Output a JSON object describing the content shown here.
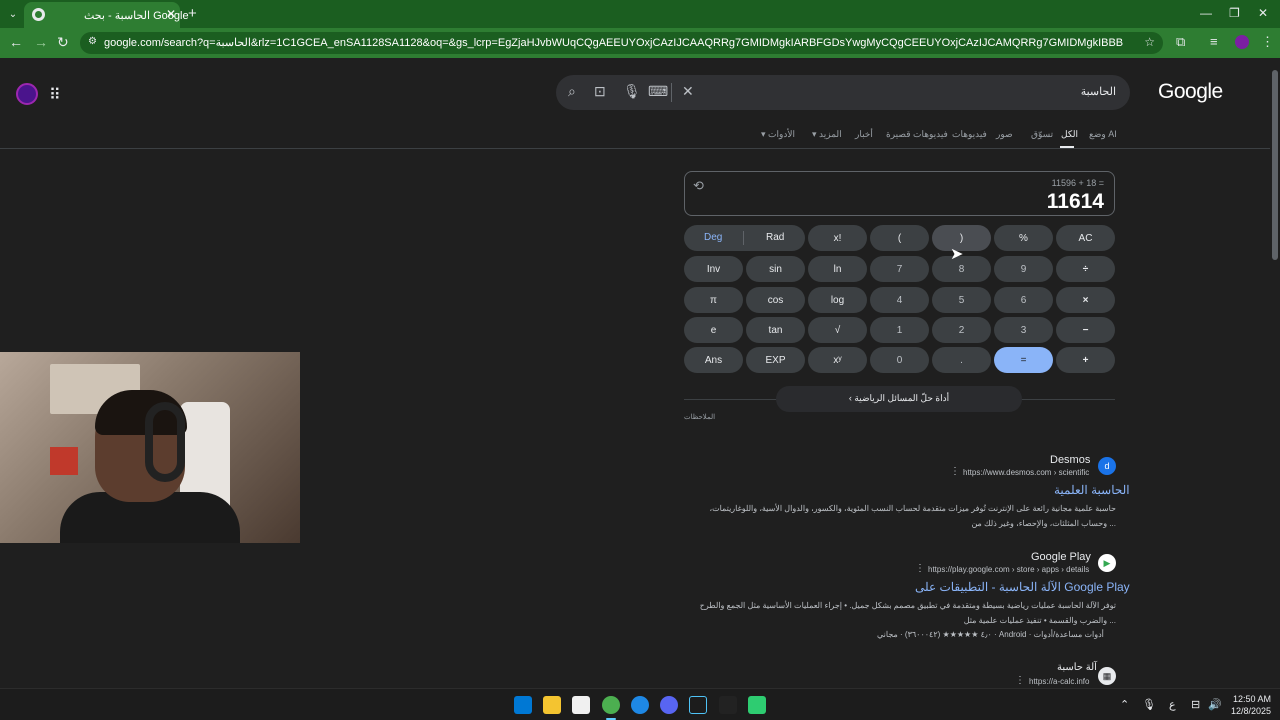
{
  "browser": {
    "tab_title": "الحاسبة - بحث Google",
    "url": "google.com/search?q=الحاسبة&rlz=1C1GCEA_enSA1128SA1128&oq=&gs_lcrp=EgZjaHJvbWUqCQgAEEUYOxjCAzIJCAAQRRg7GMIDMgkIARBFGDsYwgMyCQgCEEUYOxjCAzIJCAMQRRg7GMIDMgkIBBBFGDsYwgMyCQgFEEUYOxjCAzIJCAYQRRg7GMID..."
  },
  "search": {
    "query": "الحاسبة",
    "logo": "Google"
  },
  "nav": {
    "tabs": [
      "وضع AI",
      "الكل",
      "تسوّق",
      "صور",
      "فيديوهات",
      "فيديوهات قصيرة",
      "أخبار",
      "المزيد",
      "الأدوات"
    ]
  },
  "calculator": {
    "expression": "11596 + 18 =",
    "result": "11614",
    "keys": {
      "deg": "Deg",
      "rad": "Rad",
      "row1": [
        "x!",
        "(",
        ")",
        "%",
        "AC"
      ],
      "row2": [
        "Inv",
        "sin",
        "ln",
        "7",
        "8",
        "9",
        "÷"
      ],
      "row3": [
        "π",
        "cos",
        "log",
        "4",
        "5",
        "6",
        "×"
      ],
      "row4": [
        "e",
        "tan",
        "√",
        "1",
        "2",
        "3",
        "−"
      ],
      "row5": [
        "Ans",
        "EXP",
        "xʸ",
        "0",
        ".",
        "=",
        "+"
      ]
    },
    "solver": "أداة حلّ المسائل الرياضية",
    "feedback": "الملاحظات"
  },
  "results": [
    {
      "site": "Desmos",
      "url": "https://www.desmos.com › scientific",
      "title": "الحاسبة العلمية",
      "snippet": "حاسبة علمية مجانية رائعة على الإنترنت تُوفر ميزات متقدمة لحساب النسب المئوية، والكسور، والدوال الأسية، واللوغاريتمات، وحساب المثلثات، والإحصاء، وغير ذلك من ..."
    },
    {
      "site": "Google Play",
      "url": "https://play.google.com › store › apps › details",
      "title": "الآلة الحاسبة - التطبيقات على Google Play",
      "snippet": "توفر الآلة الحاسبة عمليات رياضية بسيطة ومتقدمة في تطبيق مصمم بشكل جميل. • إجراء العمليات الأساسية مثل الجمع والطرح والضرب والقسمة • تنفيذ عمليات علمية مثل ...",
      "rating": "٤٫٠ ★★★★★ (٣٦٠٠٠٤٢) · مجاني · Android · أدوات مساعدة/أدوات"
    },
    {
      "site": "آلة حاسبة",
      "url": "https://a-calc.info"
    }
  ],
  "taskbar": {
    "time": "12:50 AM",
    "date": "12/8/2025",
    "lang": "ع"
  }
}
